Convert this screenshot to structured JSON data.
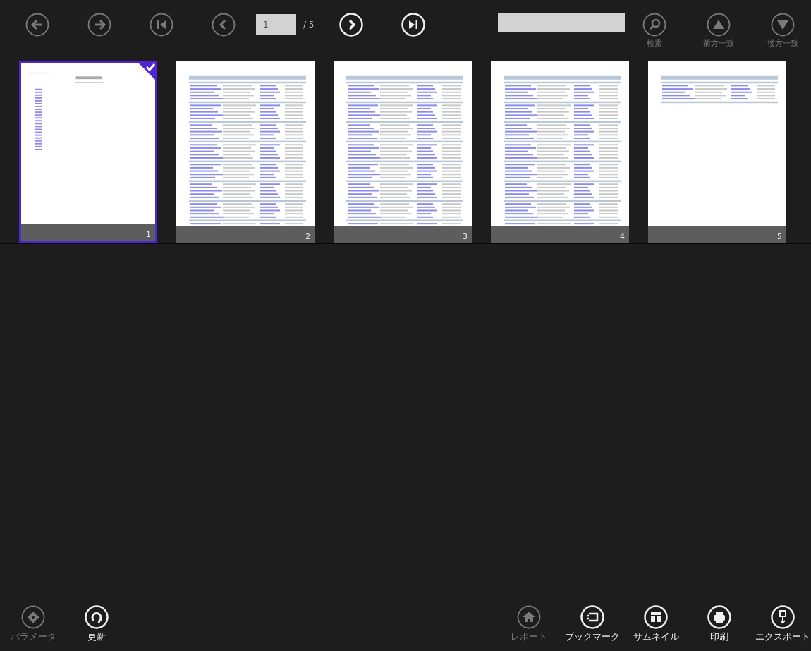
{
  "top_bar": {
    "left_buttons": [
      {
        "kind": "back",
        "disabled": true
      },
      {
        "kind": "forward",
        "disabled": true
      },
      {
        "kind": "first",
        "disabled": true
      },
      {
        "kind": "prev",
        "disabled": true
      }
    ],
    "page_field": {
      "value": "1"
    },
    "page_total": "/ 5",
    "right_nav": [
      {
        "kind": "next",
        "disabled": false
      },
      {
        "kind": "last",
        "disabled": false
      }
    ],
    "search_buttons": [
      {
        "kind": "search",
        "label": "検索",
        "disabled": true
      },
      {
        "kind": "up",
        "label": "前方一致",
        "disabled": true
      },
      {
        "kind": "down",
        "label": "後方一致",
        "disabled": true
      }
    ]
  },
  "thumbnails": [
    {
      "page": "1",
      "selected": true,
      "kind": "contents"
    },
    {
      "page": "2",
      "selected": false,
      "kind": "table"
    },
    {
      "page": "3",
      "selected": false,
      "kind": "table"
    },
    {
      "page": "4",
      "selected": false,
      "kind": "table"
    },
    {
      "page": "5",
      "selected": false,
      "kind": "table_short"
    }
  ],
  "bottom_bar": {
    "left_buttons": [
      {
        "kind": "settings",
        "label": "パラメータ",
        "disabled": true
      },
      {
        "kind": "refresh",
        "label": "更新",
        "disabled": false
      }
    ],
    "right_buttons": [
      {
        "kind": "home",
        "label": "レポート",
        "disabled": true
      },
      {
        "kind": "bookmark",
        "label": "ブックマーク",
        "disabled": false
      },
      {
        "kind": "thumbnail",
        "label": "サムネイル",
        "disabled": false
      },
      {
        "kind": "print",
        "label": "印刷",
        "disabled": false
      },
      {
        "kind": "export",
        "label": "エクスポート",
        "disabled": false
      }
    ]
  }
}
